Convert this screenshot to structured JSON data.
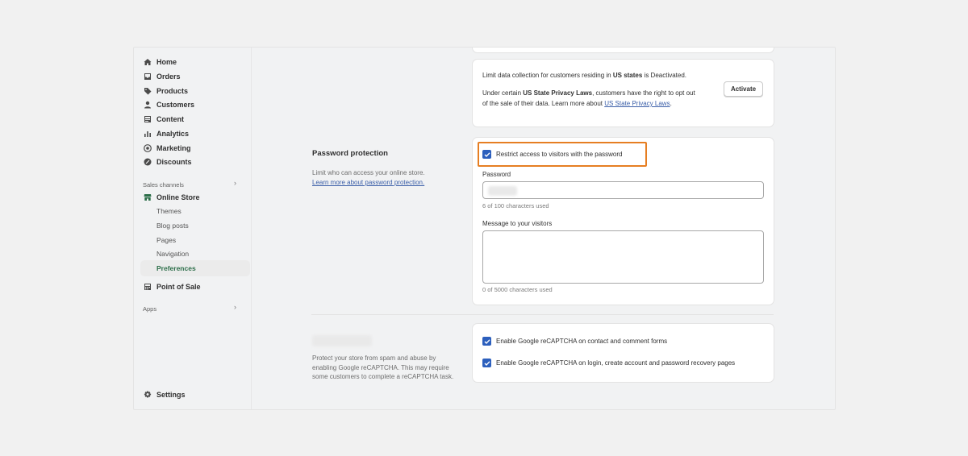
{
  "sidebar": {
    "items": [
      {
        "label": "Home",
        "icon": "home-icon"
      },
      {
        "label": "Orders",
        "icon": "inbox-icon"
      },
      {
        "label": "Products",
        "icon": "tag-icon"
      },
      {
        "label": "Customers",
        "icon": "person-icon"
      },
      {
        "label": "Content",
        "icon": "content-icon"
      },
      {
        "label": "Analytics",
        "icon": "bar-chart-icon"
      },
      {
        "label": "Marketing",
        "icon": "target-icon"
      },
      {
        "label": "Discounts",
        "icon": "discount-icon"
      }
    ],
    "sales_channels_label": "Sales channels",
    "online_store": {
      "label": "Online Store",
      "icon": "store-icon"
    },
    "sub_items": [
      "Themes",
      "Blog posts",
      "Pages",
      "Navigation",
      "Preferences"
    ],
    "point_of_sale": {
      "label": "Point of Sale",
      "icon": "pos-icon"
    },
    "apps_label": "Apps",
    "settings": {
      "label": "Settings",
      "icon": "gear-icon"
    }
  },
  "privacy_card": {
    "line1_pre": "Limit data collection for customers residing in ",
    "line1_bold": "US states",
    "line1_post": " is Deactivated.",
    "line2_pre": "Under certain ",
    "line2_bold": "US State Privacy Laws",
    "line2_post": ", customers have the right to opt out of the sale of their data. Learn more about ",
    "line2_link": "US State Privacy Laws",
    "line2_end": ".",
    "activate_button": "Activate"
  },
  "password_section": {
    "title": "Password protection",
    "description": "Limit who can access your online store.",
    "learn_link": "Learn more about password protection.",
    "restrict_label": "Restrict access to visitors with the password",
    "password_label": "Password",
    "password_count": "6 of 100 characters used",
    "message_label": "Message to your visitors",
    "message_count": "0 of 5000 characters used"
  },
  "recaptcha_section": {
    "description": "Protect your store from spam and abuse by enabling Google reCAPTCHA. This may require some customers to complete a reCAPTCHA task.",
    "option1": "Enable Google reCAPTCHA on contact and comment forms",
    "option2": "Enable Google reCAPTCHA on login, create account and password recovery pages"
  },
  "colors": {
    "accent": "#2c5fbd",
    "highlight": "#e67e22",
    "active_nav": "#2c6e49"
  }
}
